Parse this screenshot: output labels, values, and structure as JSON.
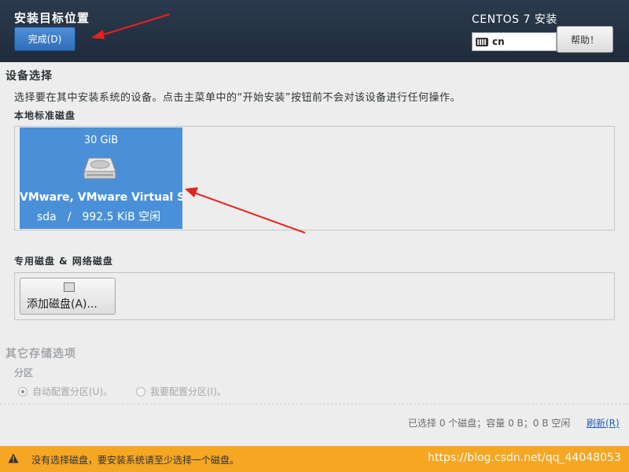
{
  "header": {
    "title": "安装目标位置",
    "done_button": "完成(D)",
    "product_title": "CENTOS 7 安装",
    "keyboard_layout": "cn",
    "help_button": "帮助！"
  },
  "device_selection": {
    "title": "设备选择",
    "description": "选择要在其中安装系统的设备。点击主菜单中的“开始安装”按钮前不会对该设备进行任何操作。",
    "local_disks_title": "本地标准磁盘",
    "disks": [
      {
        "size": "30 GiB",
        "name": "VMware, VMware Virtual S",
        "device": "sda",
        "separator": "/",
        "free": "992.5 KiB 空闲",
        "selected": true,
        "icon": "hard-drive-icon"
      }
    ],
    "special_title": "专用磁盘 & 网络磁盘",
    "add_disk_button": "添加磁盘(A)..."
  },
  "other_storage": {
    "title": "其它存储选项",
    "partition_label": "分区",
    "options": [
      {
        "label": "自动配置分区(U)。",
        "checked": true
      },
      {
        "label": "我要配置分区(I)。",
        "checked": false
      }
    ]
  },
  "footer": {
    "summary": "已选择 0 个磁盘；容量 0 B；0 B 空闲",
    "refresh_link": "刷新(R)"
  },
  "warning": {
    "icon": "warning-icon",
    "text": "没有选择磁盘，要安装系统请至少选择一个磁盘。",
    "watermark": "https://blog.csdn.net/qq_44048053"
  },
  "colors": {
    "header_bg": "#243244",
    "accent": "#4a90d9",
    "warning_bg": "#f5a623",
    "annotation_arrow": "#e8221c"
  }
}
